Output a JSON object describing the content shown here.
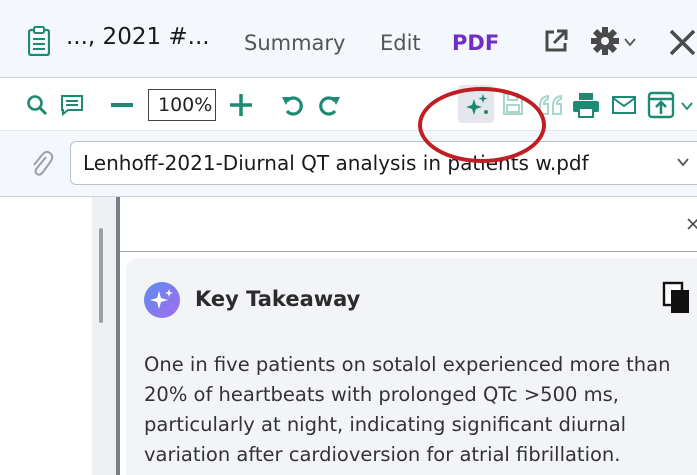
{
  "header": {
    "doc_title": "..., 2021 #...",
    "tabs": [
      {
        "label": "Summary",
        "active": false
      },
      {
        "label": "Edit",
        "active": false
      },
      {
        "label": "PDF",
        "active": true
      }
    ]
  },
  "toolbar": {
    "zoom": "100%",
    "icons": [
      "search-icon",
      "notes-icon",
      "zoom-out-icon",
      "zoom-in-icon",
      "undo-icon",
      "redo-icon",
      "ai-sparkle-icon",
      "save-icon",
      "quote-icon",
      "print-icon",
      "mail-icon",
      "export-icon"
    ]
  },
  "attachment": {
    "file_name": "Lenhoff-2021-Diurnal QT analysis in patients w.pdf"
  },
  "panel": {
    "card_title": "Key Takeaway",
    "card_body": "One in five patients on sotalol experienced more than 20% of heartbeats with prolonged QTc >500 ms, particularly at night, indicating significant diurnal variation after cardioversion for atrial fibrillation."
  },
  "colors": {
    "accent_green": "#1e8a73",
    "active_tab": "#6f2fc7",
    "annotation_red": "#bf1e23"
  }
}
